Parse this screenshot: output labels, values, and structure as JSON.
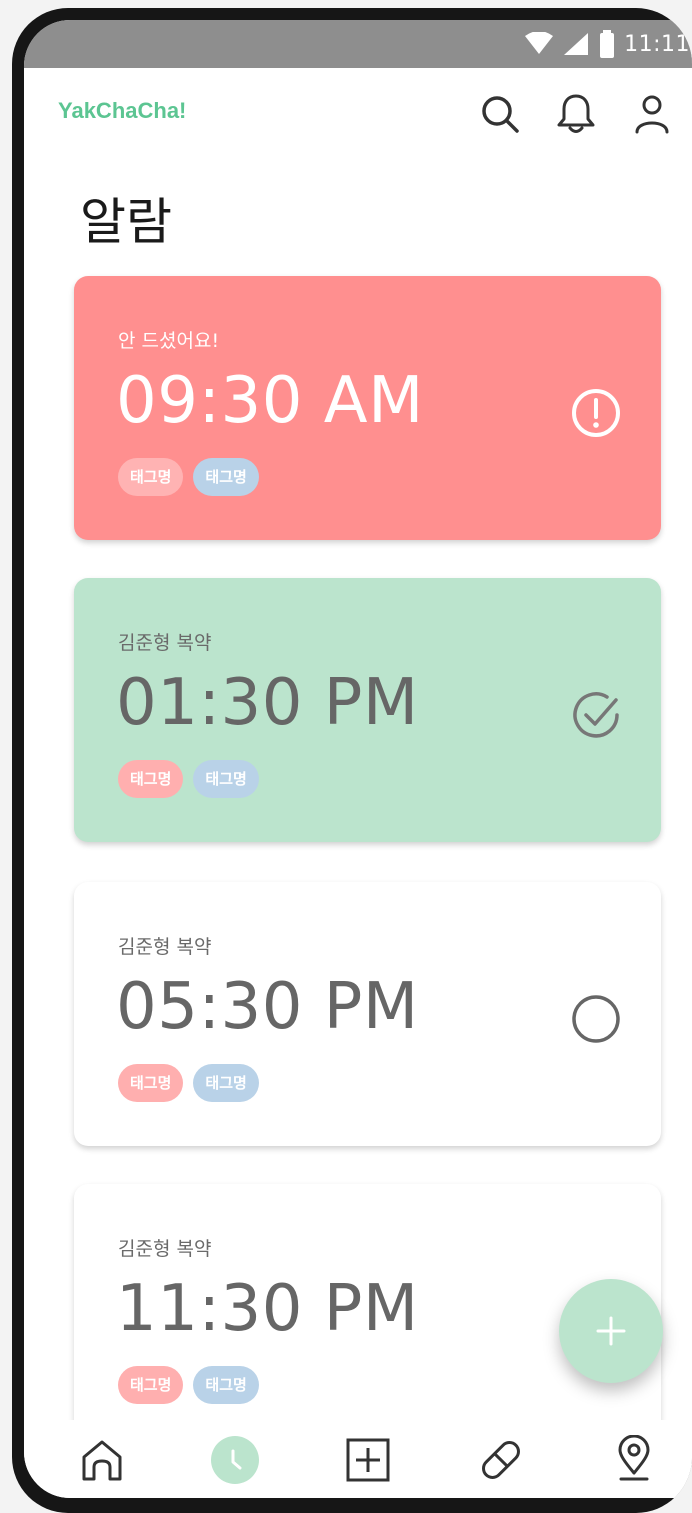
{
  "statusbar": {
    "time": "11:11"
  },
  "appbar": {
    "logo": "YakChaCha!"
  },
  "page": {
    "title": "알람"
  },
  "alarms": [
    {
      "subtitle": "안 드셨어요!",
      "time": "09:30 AM",
      "tags": [
        "태그명",
        "태그명"
      ],
      "status_icon": "alert-icon"
    },
    {
      "subtitle": "김준형 복약",
      "time": "01:30 PM",
      "tags": [
        "태그명",
        "태그명"
      ],
      "status_icon": "check-circle-icon"
    },
    {
      "subtitle": "김준형 복약",
      "time": "05:30 PM",
      "tags": [
        "태그명",
        "태그명"
      ],
      "status_icon": "empty-circle-icon"
    },
    {
      "subtitle": "김준형 복약",
      "time": "11:30 PM",
      "tags": [
        "태그명",
        "태그명"
      ],
      "status_icon": "none"
    }
  ],
  "colors": {
    "brand": "#5cc592",
    "missed": "#ff8f8f",
    "taken": "#bbe4cd",
    "pending": "#ffffff",
    "tag_pink": "#ffafaf",
    "tag_blue": "#b9d2e8",
    "fab": "#bbe4cd"
  },
  "nav": [
    {
      "name": "home",
      "icon": "home-icon"
    },
    {
      "name": "alarm",
      "icon": "clock-icon",
      "active": true
    },
    {
      "name": "add",
      "icon": "plus-square-icon"
    },
    {
      "name": "pill",
      "icon": "pill-icon"
    },
    {
      "name": "location",
      "icon": "map-pin-icon"
    }
  ]
}
